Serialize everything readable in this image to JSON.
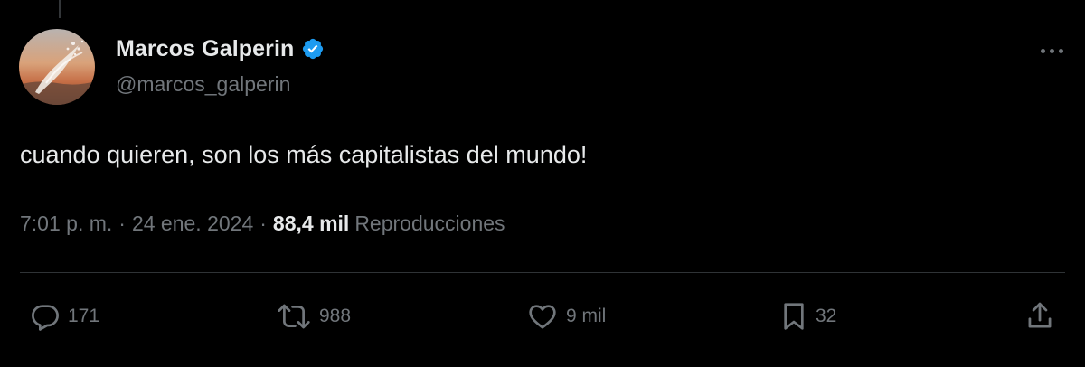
{
  "author": {
    "display_name": "Marcos Galperin",
    "handle": "@marcos_galperin",
    "verified": true
  },
  "tweet": {
    "text": "cuando quieren, son los más capitalistas del mundo!",
    "time": "7:01 p. m.",
    "date": "24 ene. 2024",
    "separator": "·",
    "views_count": "88,4 mil",
    "views_label": "Reproducciones"
  },
  "actions": {
    "replies": "171",
    "reposts": "988",
    "likes": "9 mil",
    "bookmarks": "32"
  },
  "colors": {
    "background": "#000000",
    "text_primary": "#e7e9ea",
    "text_secondary": "#71767b",
    "divider": "#2f3336",
    "verified_badge": "#1d9bf0"
  },
  "icons": {
    "more": "more-horizontal-icon",
    "verified": "verified-badge-icon",
    "reply": "reply-bubble-icon",
    "repost": "repost-arrows-icon",
    "like": "heart-icon",
    "bookmark": "bookmark-icon",
    "share": "share-upload-icon"
  }
}
